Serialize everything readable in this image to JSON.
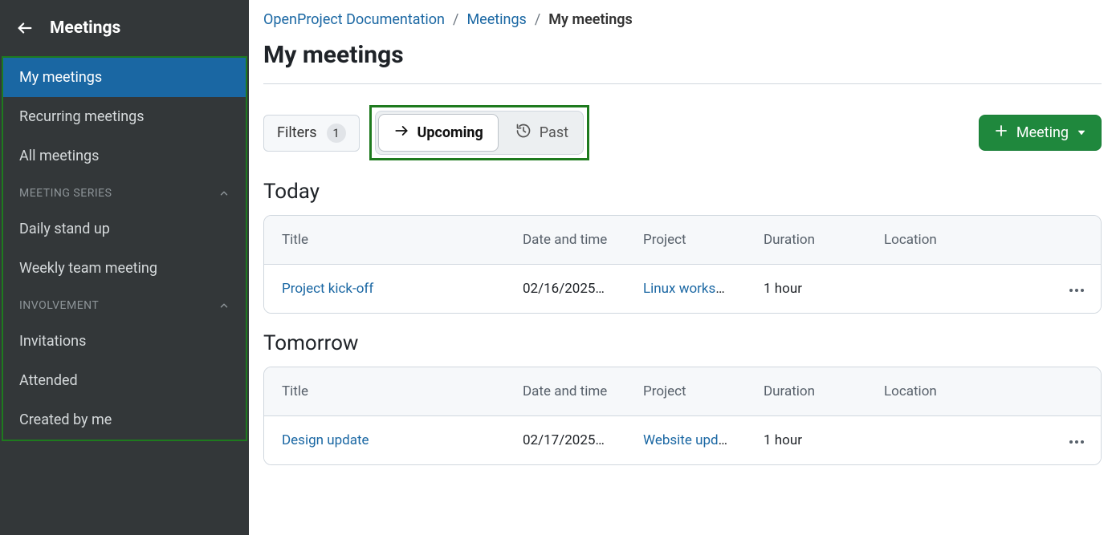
{
  "sidebar": {
    "title": "Meetings",
    "items": [
      {
        "label": "My meetings",
        "active": true
      },
      {
        "label": "Recurring meetings"
      },
      {
        "label": "All meetings"
      }
    ],
    "sections": [
      {
        "label": "MEETING SERIES",
        "items": [
          {
            "label": "Daily stand up"
          },
          {
            "label": "Weekly team meeting"
          }
        ]
      },
      {
        "label": "INVOLVEMENT",
        "items": [
          {
            "label": "Invitations"
          },
          {
            "label": "Attended"
          },
          {
            "label": "Created by me"
          }
        ]
      }
    ]
  },
  "breadcrumb": {
    "items": [
      {
        "label": "OpenProject Documentation",
        "link": true
      },
      {
        "label": "Meetings",
        "link": true
      },
      {
        "label": "My meetings",
        "link": false
      }
    ]
  },
  "page": {
    "title": "My meetings"
  },
  "toolbar": {
    "filters_label": "Filters",
    "filters_count": "1",
    "upcoming_label": "Upcoming",
    "past_label": "Past",
    "new_meeting_label": "Meeting"
  },
  "columns": {
    "title": "Title",
    "datetime": "Date and time",
    "project": "Project",
    "duration": "Duration",
    "location": "Location"
  },
  "groups": [
    {
      "heading": "Today",
      "rows": [
        {
          "title": "Project kick-off",
          "datetime": "02/16/2025 ...",
          "project": "Linux worksh...",
          "duration": "1 hour",
          "location": ""
        }
      ]
    },
    {
      "heading": "Tomorrow",
      "rows": [
        {
          "title": "Design update",
          "datetime": "02/17/2025 ...",
          "project": "Website upd...",
          "duration": "1 hour",
          "location": ""
        }
      ]
    }
  ]
}
